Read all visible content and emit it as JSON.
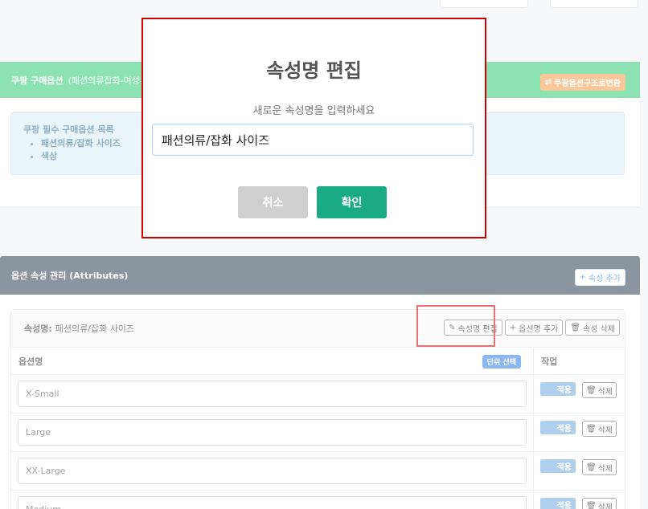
{
  "coupang_panel": {
    "title": "쿠팡 구매옵션",
    "subtitle": "(패션의류잡화-여성",
    "convert_button": "쿠팡옵션구조로변환",
    "info_title": "쿠팡 필수 구매옵션 목록",
    "info_items": [
      "패션의류/잡화 사이즈",
      "색상"
    ]
  },
  "attributes_panel": {
    "title": "옵션 속성 관리 (Attributes)",
    "add_button": "속성 추가",
    "attribute_label": "속성명:",
    "attribute_name": "패션의류/잡화 사이즈",
    "edit_button": "속성명 편집",
    "add_option_button": "옵션명 추가",
    "delete_attr_button": "속성 삭제",
    "col_option_name": "옵션명",
    "unit_select_button": "단위 선택",
    "col_action": "작업",
    "apply_label": "적용",
    "delete_label": "삭제",
    "options": [
      "X-Small",
      "Large",
      "XX-Large",
      "Medium"
    ]
  },
  "modal": {
    "title": "속성명 편집",
    "label": "새로운 속성명을 입력하세요",
    "input_value": "패션의류/잡화 사이즈",
    "cancel": "취소",
    "confirm": "확인"
  }
}
